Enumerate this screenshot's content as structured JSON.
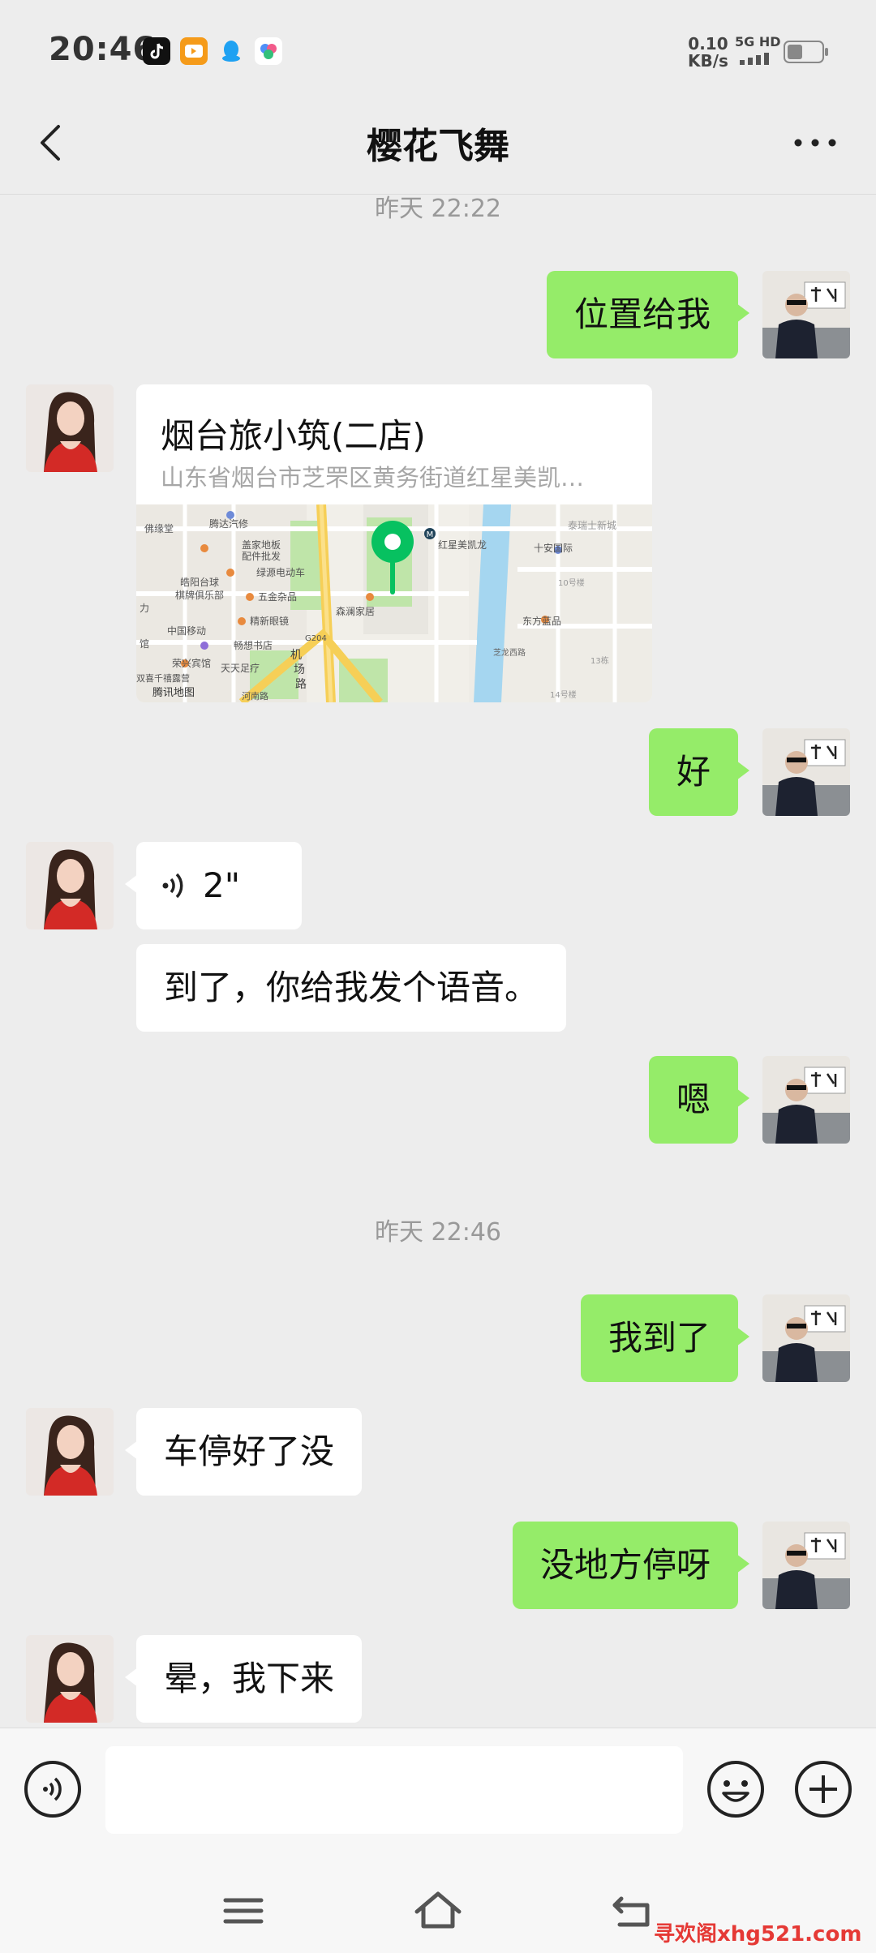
{
  "status_bar": {
    "time": "20:46",
    "net_speed_value": "0.10",
    "net_speed_unit": "KB/s",
    "network": "5G HD"
  },
  "header": {
    "title": "樱花飞舞"
  },
  "colors": {
    "bubble_sent": "#95ec69",
    "bubble_received": "#ffffff",
    "background": "#ededed",
    "map_pin": "#07c160"
  },
  "messages": {
    "ts1": "昨天 22:22",
    "m1": "位置给我",
    "location": {
      "name": "烟台旅小筑(二店)",
      "address": "山东省烟台市芝罘区黄务街道红星美凯…"
    },
    "map_labels": {
      "l1": "佛缘堂",
      "l2": "腾达汽修",
      "l3": "盖家地板",
      "l4": "配件批发",
      "l5": "绿源电动车",
      "l6": "皓阳台球",
      "l7": "棋牌俱乐部",
      "l8": "五金杂品",
      "l9": "精新眼镜",
      "l10": "中国移动",
      "l11": "畅想书店",
      "l12": "荣兴宾馆",
      "l13": "天天足疗",
      "l14": "森澜家居",
      "l15": "红星美凯龙",
      "l16": "泰瑞士新城",
      "l17": "十安国际",
      "l18": "东方蓝品",
      "l19": "机",
      "l20": "场",
      "l21": "路",
      "l22": "G204",
      "l23": "10号楼",
      "l24": "14号楼",
      "l25": "13栋",
      "l26": "芝龙西路",
      "l27": "腾讯地图",
      "l28": "力",
      "l29": "馆",
      "l30": "双喜千禧露营",
      "l31": "河南路",
      "l32": "M"
    },
    "m2": "好",
    "voice_duration": "2\"",
    "m3": "到了，你给我发个语音。",
    "m4": "嗯",
    "ts2": "昨天 22:46",
    "m5": "我到了",
    "m6": "车停好了没",
    "m7": "没地方停呀",
    "m8": "晕，我下来"
  },
  "watermark": "寻欢阁xhg521.com"
}
